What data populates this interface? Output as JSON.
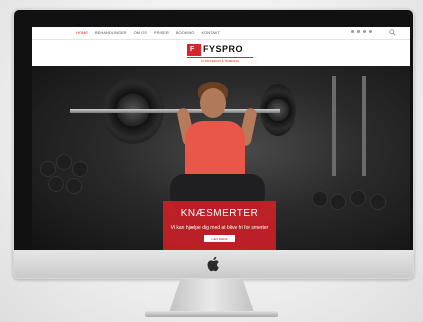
{
  "nav": {
    "items": [
      "HOME",
      "BEHANDLINGER",
      "OM OS",
      "PRISER",
      "BOOKING",
      "KONTAKT"
    ],
    "active_index": 0
  },
  "logo": {
    "brand": "FYSPRO",
    "tagline": "FYSIOTERAPI & TRÆNING"
  },
  "hero": {
    "title": "KNÆSMERTER",
    "subtitle": "Vi kan hjælpe dig med at blive fri for smerter",
    "cta_label": "LÆS MERE"
  },
  "colors": {
    "accent": "#d9232d",
    "overlay": "#d02028"
  },
  "icons": [
    "search-icon",
    "apple-logo-icon"
  ]
}
